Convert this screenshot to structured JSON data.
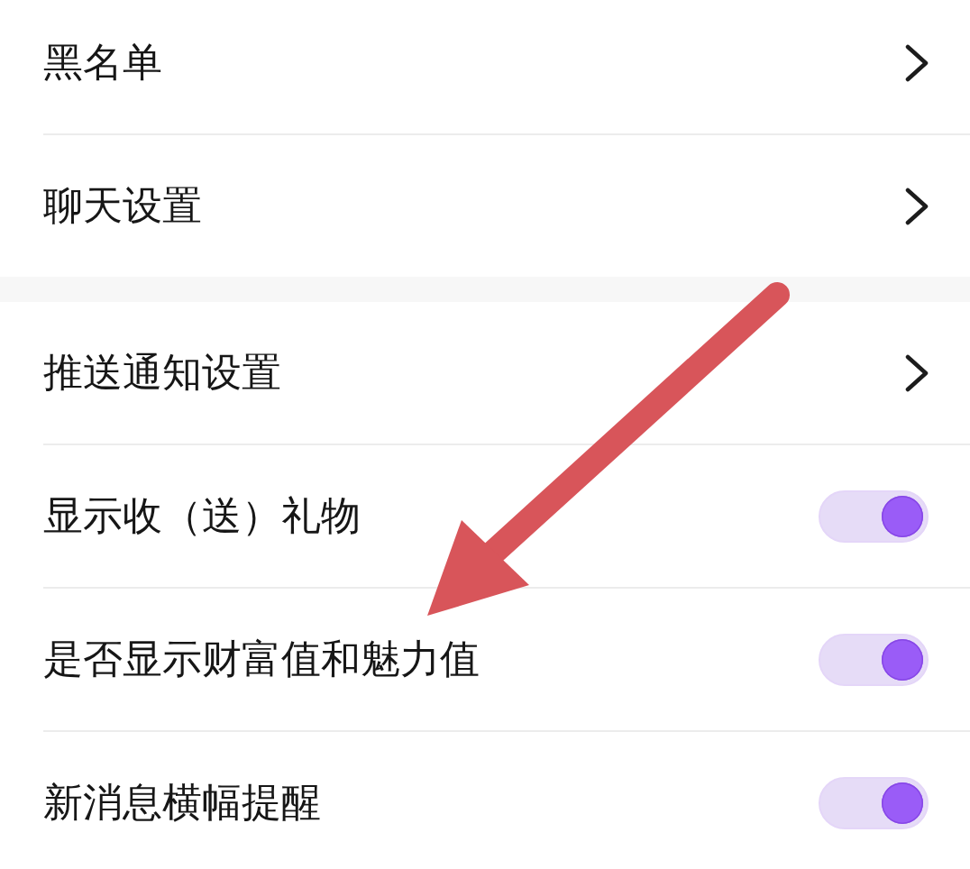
{
  "sections": [
    {
      "items": [
        {
          "kind": "link",
          "label": "黑名单"
        },
        {
          "kind": "link",
          "label": "聊天设置"
        }
      ]
    },
    {
      "items": [
        {
          "kind": "link",
          "label": "推送通知设置"
        },
        {
          "kind": "toggle",
          "label": "显示收（送）礼物",
          "on": true
        },
        {
          "kind": "toggle",
          "label": "是否显示财富值和魅力值",
          "on": true
        },
        {
          "kind": "toggle",
          "label": "新消息横幅提醒",
          "on": true
        }
      ]
    }
  ]
}
